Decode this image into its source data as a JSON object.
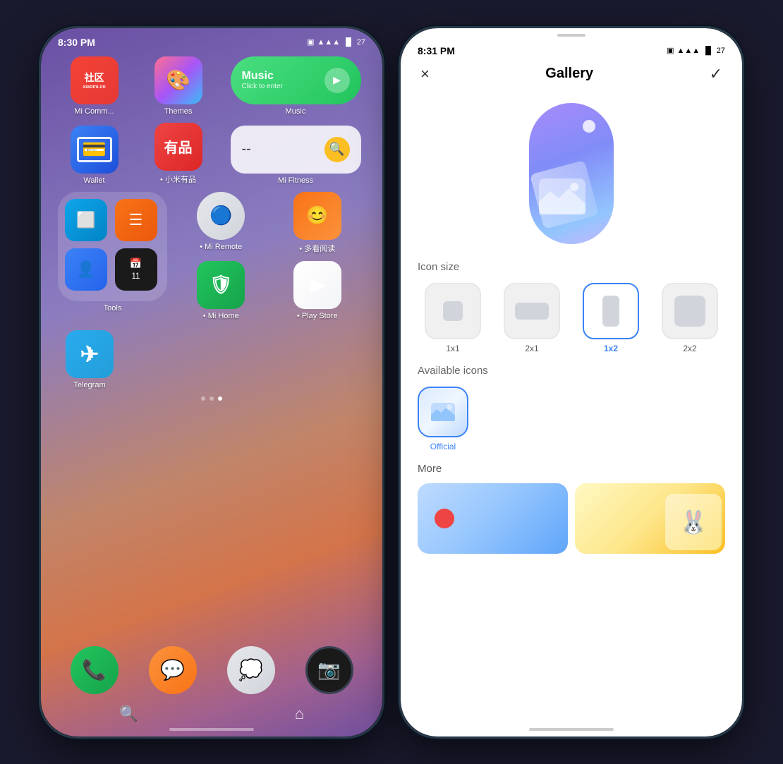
{
  "phone1": {
    "statusBar": {
      "time": "8:30 PM",
      "icons": "📷 📶 🔋"
    },
    "apps": {
      "row1": [
        {
          "id": "mi-community",
          "label": "Mi Comm...",
          "dot": false
        },
        {
          "id": "themes",
          "label": "Themes",
          "dot": false
        },
        {
          "id": "music",
          "label": "Music",
          "dot": false,
          "widget": true
        }
      ],
      "row2": [
        {
          "id": "wallet",
          "label": "Wallet",
          "dot": false
        },
        {
          "id": "youpin",
          "label": "小米有品",
          "dot": true
        },
        {
          "id": "fitness",
          "label": "Mi Fitness",
          "dot": false,
          "widget": true
        }
      ],
      "tools": {
        "label": "Tools",
        "items": [
          "screen-capture",
          "menu",
          "contacts",
          "multi-app"
        ],
        "rightApps": [
          {
            "id": "mi-remote",
            "label": "Mi Remote",
            "dot": true
          },
          {
            "id": "reader",
            "label": "多看阅读",
            "dot": true
          },
          {
            "id": "mi-home",
            "label": "Mi Home",
            "dot": true
          },
          {
            "id": "play-store",
            "label": "Play Store",
            "dot": true
          }
        ]
      },
      "telegram": {
        "label": "Telegram"
      },
      "dock": [
        "phone",
        "messages",
        "bubbles",
        "camera"
      ]
    },
    "dotsIndicator": [
      false,
      false,
      true
    ],
    "bottomBar": {
      "search": "🔍",
      "home": "⌂"
    }
  },
  "phone2": {
    "statusBar": {
      "time": "8:31 PM",
      "icons": "📷 📶 🔋"
    },
    "header": {
      "close": "×",
      "title": "Gallery",
      "check": "✓"
    },
    "iconSize": {
      "label": "Icon size",
      "options": [
        {
          "id": "1x1",
          "label": "1x1",
          "selected": false
        },
        {
          "id": "2x1",
          "label": "2x1",
          "selected": false
        },
        {
          "id": "1x2",
          "label": "1x2",
          "selected": true
        },
        {
          "id": "2x2",
          "label": "2x2",
          "selected": false
        }
      ]
    },
    "availableIcons": {
      "label": "Available icons",
      "items": [
        {
          "id": "official",
          "label": "Official",
          "selected": true
        }
      ]
    },
    "more": {
      "label": "More"
    }
  }
}
